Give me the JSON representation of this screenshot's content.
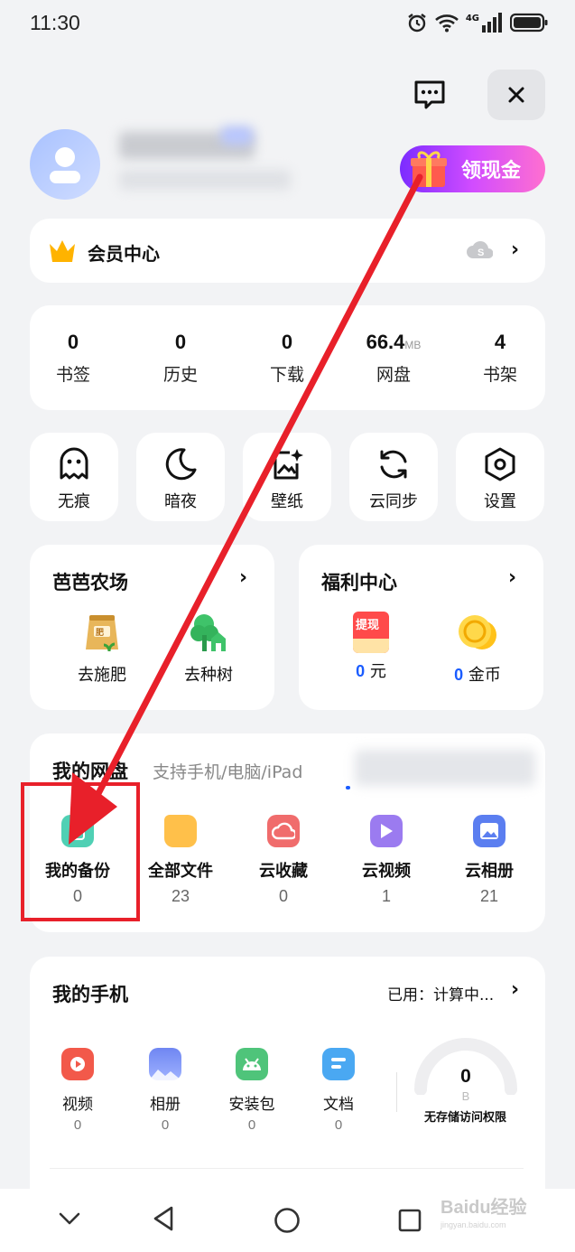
{
  "status": {
    "time": "11:30",
    "signal_label": "4G"
  },
  "header": {
    "chat_icon": "chat-bubble-icon",
    "close_icon": "close-icon"
  },
  "profile": {
    "cash_button_label": "领现金"
  },
  "member": {
    "label": "会员中心"
  },
  "stats": [
    {
      "value": "0",
      "unit": "",
      "label": "书签"
    },
    {
      "value": "0",
      "unit": "",
      "label": "历史"
    },
    {
      "value": "0",
      "unit": "",
      "label": "下载"
    },
    {
      "value": "66.4",
      "unit": "MB",
      "label": "网盘"
    },
    {
      "value": "4",
      "unit": "",
      "label": "书架"
    }
  ],
  "tools": [
    {
      "label": "无痕",
      "icon": "ghost-icon"
    },
    {
      "label": "暗夜",
      "icon": "moon-icon"
    },
    {
      "label": "壁纸",
      "icon": "wallpaper-icon"
    },
    {
      "label": "云同步",
      "icon": "sync-icon"
    },
    {
      "label": "设置",
      "icon": "settings-icon"
    }
  ],
  "farm": {
    "title": "芭芭农场",
    "items": [
      {
        "label": "去施肥"
      },
      {
        "label": "去种树"
      }
    ]
  },
  "welfare": {
    "title": "福利中心",
    "badge": "提现",
    "cash": {
      "value": "0",
      "unit": "元"
    },
    "coins": {
      "value": "0",
      "unit": "金币"
    }
  },
  "netdisk": {
    "title": "我的网盘",
    "subtitle": "支持手机/电脑/iPad",
    "items": [
      {
        "label": "我的备份",
        "count": "0",
        "color": "#4fd0b4"
      },
      {
        "label": "全部文件",
        "count": "23",
        "color": "#ffc04a"
      },
      {
        "label": "云收藏",
        "count": "0",
        "color": "#f06c6c"
      },
      {
        "label": "云视频",
        "count": "1",
        "color": "#9b7bf0"
      },
      {
        "label": "云相册",
        "count": "21",
        "color": "#5b7ef0"
      }
    ]
  },
  "phone": {
    "title": "我的手机",
    "used_label": "已用：计算中...",
    "items": [
      {
        "label": "视频",
        "count": "0",
        "color": "#f2594a"
      },
      {
        "label": "相册",
        "count": "0",
        "color": "#6f86f2"
      },
      {
        "label": "安装包",
        "count": "0",
        "color": "#4fc47a"
      },
      {
        "label": "文档",
        "count": "0",
        "color": "#4aa8f2"
      }
    ],
    "storage_value": "0",
    "storage_unit": "B",
    "storage_note": "无存储访问权限"
  },
  "watermark": {
    "text": "Baidu经验",
    "sub": "jingyan.baidu.com"
  },
  "colors": {
    "accent_red": "#e8202a",
    "number_blue": "#1a5cff"
  }
}
